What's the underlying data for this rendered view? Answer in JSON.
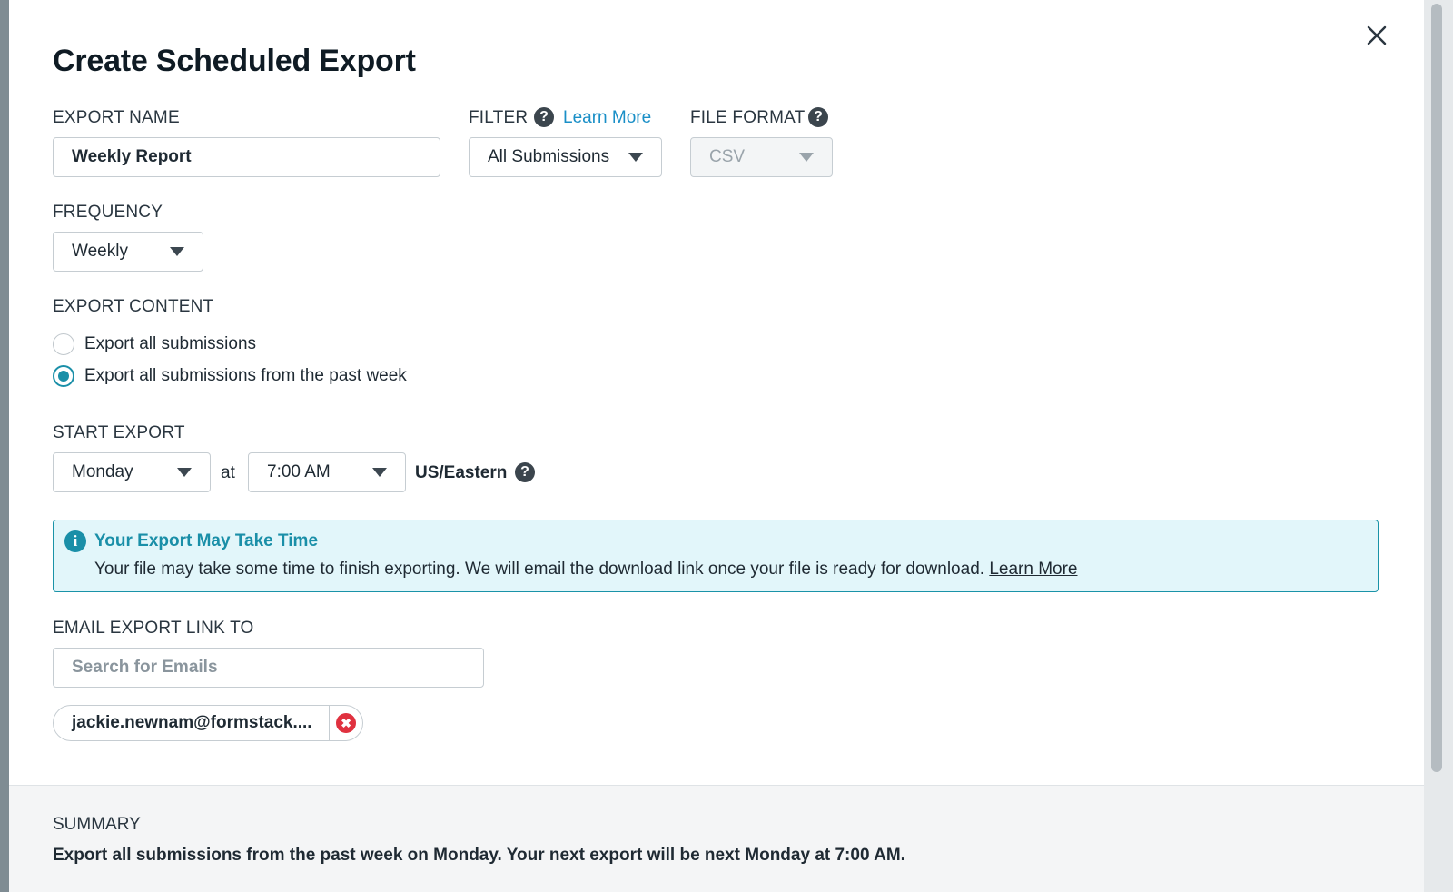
{
  "dialog": {
    "title": "Create Scheduled Export",
    "close_icon": "close-icon"
  },
  "export_name": {
    "label": "EXPORT NAME",
    "value": "Weekly Report"
  },
  "filter": {
    "label": "FILTER",
    "help_icon": "question-circle-icon",
    "help_glyph": "?",
    "learn_more": "Learn More",
    "selected": "All Submissions"
  },
  "file_format": {
    "label": "FILE FORMAT",
    "help_glyph": "?",
    "selected": "CSV",
    "disabled": true
  },
  "frequency": {
    "label": "FREQUENCY",
    "selected": "Weekly"
  },
  "export_content": {
    "label": "EXPORT CONTENT",
    "options": [
      {
        "label": "Export all submissions",
        "checked": false
      },
      {
        "label": "Export all submissions from the past week",
        "checked": true
      }
    ]
  },
  "start_export": {
    "label": "START EXPORT",
    "day": "Monday",
    "at_text": "at",
    "time": "7:00 AM",
    "timezone": "US/Eastern",
    "help_glyph": "?"
  },
  "alert": {
    "icon": "info-icon",
    "icon_glyph": "i",
    "title": "Your Export May Take Time",
    "body": "Your file may take some time to finish exporting. We will email the download link once your file is ready for download.",
    "link": "Learn More",
    "accent_color": "#1a8fa8",
    "background_color": "#e2f6fa"
  },
  "email": {
    "label": "EMAIL EXPORT LINK TO",
    "placeholder": "Search for Emails",
    "chips": [
      {
        "text": "jackie.newnam@formstack....",
        "remove_glyph": "✖"
      }
    ]
  },
  "summary": {
    "label": "SUMMARY",
    "text": "Export all submissions from the past week on Monday. Your next export will be next Monday at 7:00 AM."
  }
}
